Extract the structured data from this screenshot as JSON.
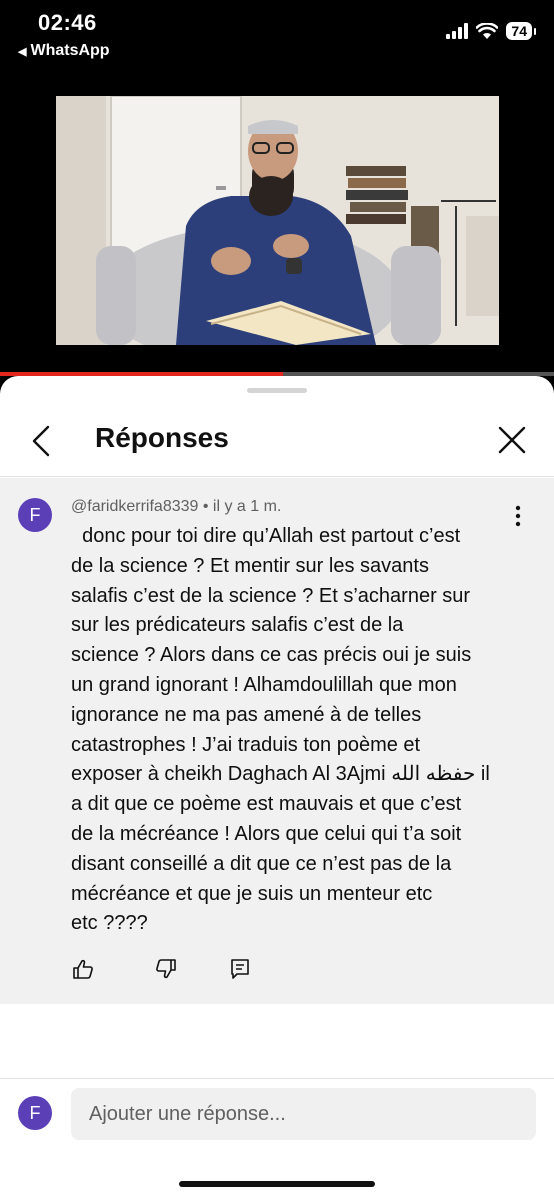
{
  "status_bar": {
    "time": "02:46",
    "back_app": "WhatsApp",
    "battery": "74"
  },
  "video": {
    "progress": 0.51
  },
  "panel": {
    "title": "Réponses"
  },
  "comment": {
    "avatar_letter": "F",
    "author": "@faridkerrifa8339",
    "time": "il y a 1 m.",
    "text": "  donc pour toi dire qu’Allah est partout c’est\nde la science ? Et mentir sur les savants\nsalafis c’est de la science ? Et s’acharner sur\nsur les prédicateurs salafis c’est de la\nscience ? Alors dans ce cas précis oui je suis\nun grand ignorant ! Alhamdoulillah que mon\nignorance ne ma pas amené à de telles\ncatastrophes ! J’ai traduis ton poème et\nexposer à cheikh Daghach Al 3Ajmi حفظه الله il\na dit que ce poème est mauvais et que c’est\nde la mécréance ! Alors que celui qui t’a soit\ndisant conseillé a dit que ce n’est pas de la\nmécréance et que je suis un menteur etc\netc ????"
  },
  "reply": {
    "avatar_letter": "F",
    "placeholder": "Ajouter une réponse..."
  },
  "colors": {
    "avatar": "#5b3fb6",
    "progress": "#e5261c",
    "comment_bg": "#f1f1f1"
  },
  "icons": [
    "signal-icon",
    "wifi-icon",
    "battery-icon",
    "back-chevron-icon",
    "close-icon",
    "more-vert-icon",
    "thumb-up-icon",
    "thumb-down-icon",
    "reply-icon"
  ]
}
